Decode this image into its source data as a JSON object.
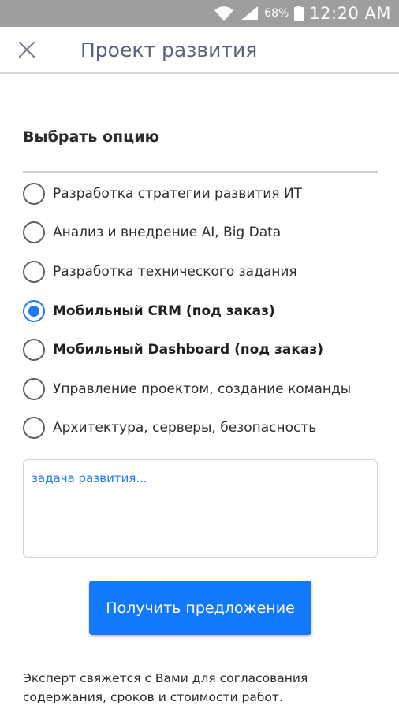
{
  "status_bar": {
    "battery_percent": "68%",
    "time": "12:20 AM",
    "icons": [
      "wifi-icon",
      "signal-icon",
      "battery-icon"
    ]
  },
  "app_bar": {
    "close_icon": "close-icon",
    "title": "Проект развития"
  },
  "section": {
    "title": "Выбрать опцию"
  },
  "options": [
    {
      "label": "Разработка стратегии развития ИТ",
      "selected": false,
      "bold": false
    },
    {
      "label": "Анализ и внедрение AI, Big Data",
      "selected": false,
      "bold": false
    },
    {
      "label": "Разработка технического задания",
      "selected": false,
      "bold": false
    },
    {
      "label": "Мобильный CRM (под заказ)",
      "selected": true,
      "bold": true
    },
    {
      "label": "Мобильный Dashboard (под заказ)",
      "selected": false,
      "bold": true
    },
    {
      "label": "Управление проектом, создание команды",
      "selected": false,
      "bold": false
    },
    {
      "label": "Архитектура, серверы, безопасность",
      "selected": false,
      "bold": false
    }
  ],
  "task_input": {
    "value": "",
    "placeholder": "задача развития..."
  },
  "submit": {
    "label": "Получить предложение"
  },
  "footer": {
    "text": "Эксперт свяжется с Вами для согласования содержания, сроков и стоимости работ."
  },
  "colors": {
    "accent": "#1e78f0",
    "button": "#1279fa",
    "status_bar": "#9e9e9e",
    "title": "#5a6275"
  }
}
